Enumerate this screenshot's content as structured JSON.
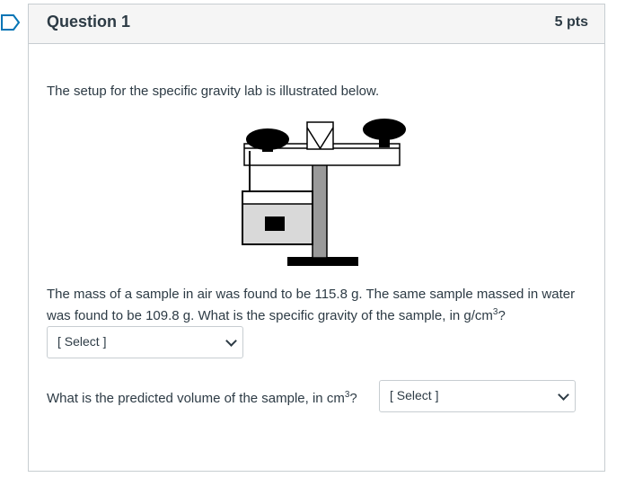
{
  "question": {
    "title": "Question 1",
    "points": "5 pts",
    "intro": "The setup for the specific gravity lab is illustrated below.",
    "body_text": "The mass of a sample in air was found to be 115.8 g. The same sample massed in water was found to be 109.8 g. What is the specific gravity of the sample, in g/cm",
    "body_sup": "3",
    "body_end": "?",
    "select1": {
      "value": "[ Select ]"
    },
    "q2_text": "What is the predicted volume of the sample, in cm",
    "q2_sup": "3",
    "q2_end": "?",
    "select2": {
      "value": "[ Select ]"
    }
  },
  "colors": {
    "accent_flag": "#0374b5",
    "text": "#2d3b45",
    "border": "#c7cdd1",
    "header_bg": "#f5f5f5"
  },
  "icons": {
    "flag": "flag-bookmark-icon",
    "dropdown": "chevron-down-icon"
  }
}
